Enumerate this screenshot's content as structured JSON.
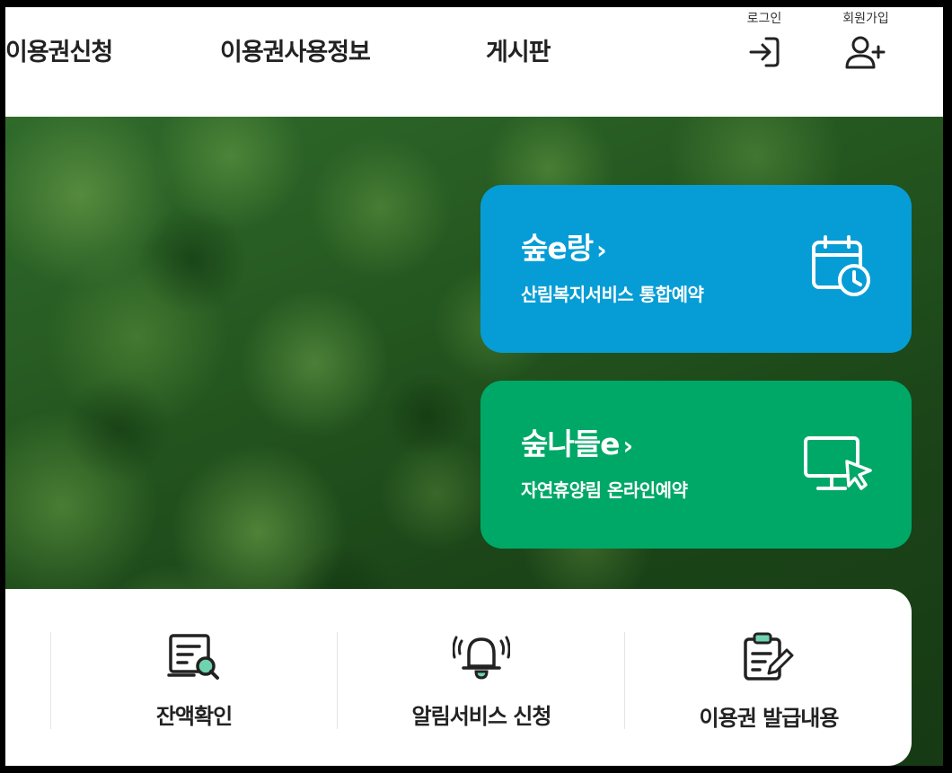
{
  "header": {
    "nav": [
      {
        "label": "이용권신청"
      },
      {
        "label": "이용권사용정보"
      },
      {
        "label": "게시판"
      }
    ],
    "login": {
      "label": "로그인",
      "icon": "login-arrow-icon"
    },
    "signup": {
      "label": "회원가입",
      "icon": "user-plus-icon"
    }
  },
  "cards": [
    {
      "title": "숲e랑",
      "chevron": "›",
      "description": "산림복지서비스 통합예약",
      "icon": "calendar-clock-icon",
      "color": "#069dd6"
    },
    {
      "title": "숲나들e",
      "chevron": "›",
      "description": "자연휴양림 온라인예약",
      "icon": "monitor-cursor-icon",
      "color": "#00a867"
    }
  ],
  "quick_menu": [
    {
      "label": "잔액확인",
      "icon": "receipt-search-icon"
    },
    {
      "label": "알림서비스 신청",
      "icon": "bell-icon"
    },
    {
      "label": "이용권 발급내용",
      "icon": "clipboard-edit-icon"
    }
  ],
  "colors": {
    "accent_mint": "#6fd3b0",
    "text_dark": "#222222"
  }
}
